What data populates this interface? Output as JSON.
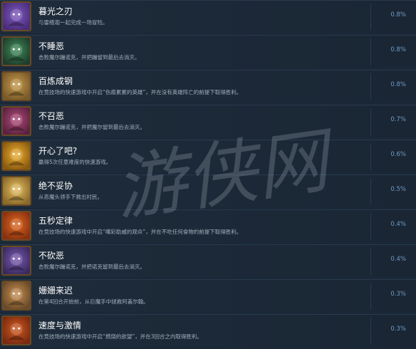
{
  "achievements": [
    {
      "title": "暮光之刃",
      "desc": "与雷楂迦一起完成一场冒险。",
      "percent": "0.8%",
      "icon": "twilight-blade-icon",
      "c1": "#4a2c7a",
      "c2": "#7d5bc0"
    },
    {
      "title": "不睡恶",
      "desc": "击败魔尔蹦诺克，并把蹦留到最后去淌灭。",
      "percent": "0.8%",
      "icon": "sleepless-evil-icon",
      "c1": "#1f3d2c",
      "c2": "#3f8e5a"
    },
    {
      "title": "百炼成钢",
      "desc": "在竞技场的快速游戏中开启“伤痕累累的英雄”，并在没有英雄阵亡的前提下取得胜利。",
      "percent": "0.8%",
      "icon": "tempered-steel-icon",
      "c1": "#7a5a2a",
      "c2": "#c59a4a"
    },
    {
      "title": "不召恶",
      "desc": "击败魔尔蹦诺克，并把魔尔留到最后去淌灭。",
      "percent": "0.7%",
      "icon": "unsummoned-evil-icon",
      "c1": "#5a2240",
      "c2": "#b24a7a"
    },
    {
      "title": "开心了吧?",
      "desc": "赢得5次任意难度的快速游戏。",
      "percent": "0.6%",
      "icon": "happy-now-icon",
      "c1": "#8a5a10",
      "c2": "#f0b030"
    },
    {
      "title": "绝不妥协",
      "desc": "从恶魔头领手下救出村民。",
      "percent": "0.5%",
      "icon": "no-compromise-icon",
      "c1": "#8a6a2a",
      "c2": "#e8c060"
    },
    {
      "title": "五秒定律",
      "desc": "在竞技场的快速游戏中开启“嘴彩助威的观众”，并在不吃任何食物的前提下取得胜利。",
      "percent": "0.4%",
      "icon": "five-second-rule-icon",
      "c1": "#8a3010",
      "c2": "#e06a20"
    },
    {
      "title": "不砍恶",
      "desc": "击败魔尔蹦诺克，并把诺克留到最后去淌灭。",
      "percent": "0.4%",
      "icon": "unslain-evil-icon",
      "c1": "#3a2a60",
      "c2": "#7a5ab0"
    },
    {
      "title": "姗姗来迟",
      "desc": "在第4回合开始前，从巨魔手中拯救阿盖尔翰。",
      "percent": "0.3%",
      "icon": "fashionably-late-icon",
      "c1": "#6a4a2a",
      "c2": "#c89050"
    },
    {
      "title": "速度与激情",
      "desc": "在竞技场的快速游戏中开启“燃烧的欲望”，并在3回合之内取得胜利。",
      "percent": "0.3%",
      "icon": "fast-furious-icon",
      "c1": "#7a2a10",
      "c2": "#d05a20"
    }
  ],
  "watermark_text": "游侠网"
}
